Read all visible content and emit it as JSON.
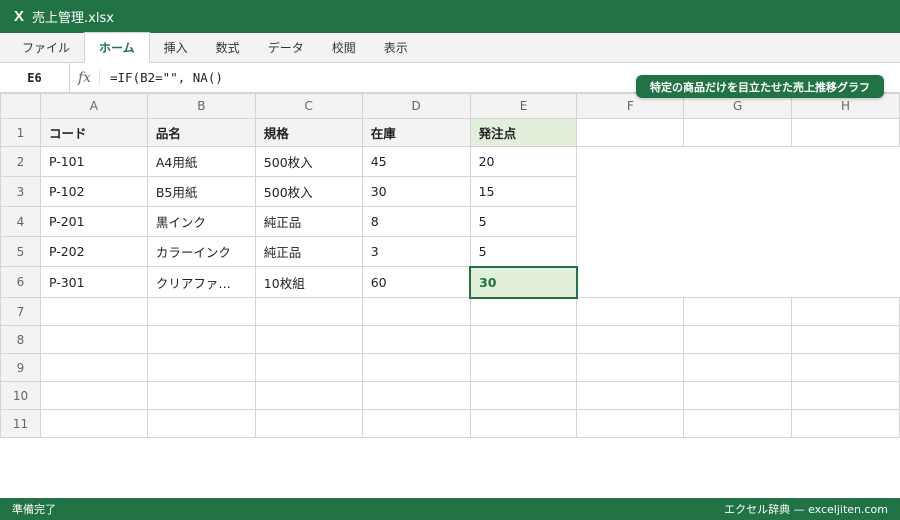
{
  "window": {
    "logo": "X",
    "title": "売上管理.xlsx"
  },
  "ribbon": {
    "tabs": [
      "ファイル",
      "ホーム",
      "挿入",
      "数式",
      "データ",
      "校閲",
      "表示"
    ],
    "active_tab": "ホーム"
  },
  "formula_bar": {
    "cell_ref": "E6",
    "fx": "fx",
    "formula": "=IF(B2=\"\", NA()"
  },
  "badge": "特定の商品だけを目立たせた売上推移グラフ",
  "sheet": {
    "columns": [
      "A",
      "B",
      "C",
      "D",
      "E",
      "F",
      "G",
      "H"
    ],
    "rows": [
      [
        "コード",
        "品名",
        "規格",
        "在庫",
        "発注点"
      ],
      [
        "P-101",
        "A4用紙",
        "500枚入",
        "45",
        "20"
      ],
      [
        "P-102",
        "B5用紙",
        "500枚入",
        "30",
        "15"
      ],
      [
        "P-201",
        "黒インク",
        "純正品",
        "8",
        "5"
      ],
      [
        "P-202",
        "カラーインク",
        "純正品",
        "3",
        "5"
      ],
      [
        "P-301",
        "クリアファ…",
        "10枚組",
        "60",
        "30"
      ]
    ],
    "row_numbers": [
      "1",
      "2",
      "3",
      "4",
      "5",
      "6",
      "7",
      "8",
      "9",
      "10",
      "11"
    ],
    "active_cell": "E6"
  },
  "status": {
    "left": "準備完了",
    "right": "エクセル辞典 — exceljiten.com"
  },
  "colors": {
    "accent": "#217346",
    "selection_fill": "#e2efda",
    "gridline": "#d4d4d4",
    "header_bg": "#f3f3f3"
  }
}
